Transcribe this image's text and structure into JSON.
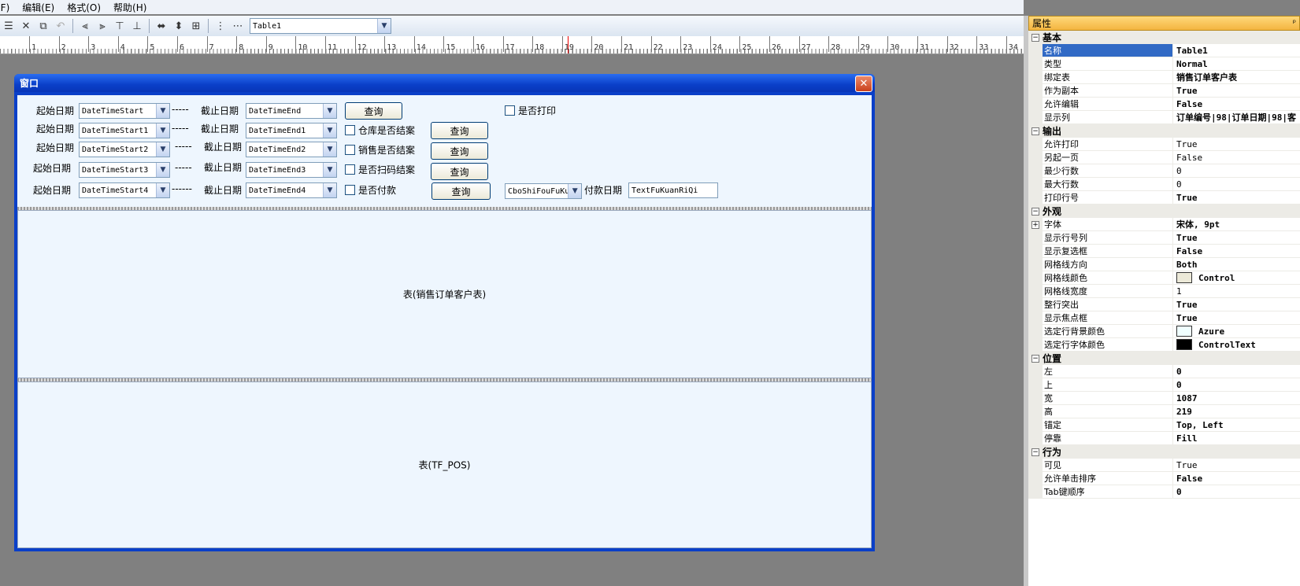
{
  "menu": [
    "文件(F)",
    "编辑(E)",
    "格式(O)",
    "帮助(H)"
  ],
  "toolbar": {
    "table_select": "Table1"
  },
  "ruler": {
    "numbers": [
      "1",
      "2",
      "3",
      "4",
      "5",
      "6",
      "7",
      "8",
      "9",
      "10",
      "11",
      "12",
      "13",
      "14",
      "15",
      "16",
      "17",
      "18",
      "19",
      "20",
      "21",
      "22",
      "23",
      "24",
      "25",
      "26",
      "27",
      "28",
      "29",
      "30",
      "31",
      "32",
      "33",
      "34"
    ]
  },
  "window": {
    "title": "窗口",
    "close": "✕",
    "rows": [
      {
        "start_label": "起始日期",
        "start_value": "DateTimeStart",
        "sep": "-----",
        "end_label": "截止日期",
        "end_value": "DateTimeEnd",
        "query": "查询",
        "check": "是否打印"
      },
      {
        "start_label": "起始日期",
        "start_value": "DateTimeStart1",
        "sep": "-----",
        "end_label": "截止日期",
        "end_value": "DateTimeEnd1",
        "check": "仓库是否结案",
        "query": "查询"
      },
      {
        "start_label": "起始日期",
        "start_value": "DateTimeStart2",
        "sep": "-----",
        "end_label": "截止日期",
        "end_value": "DateTimeEnd2",
        "check": "销售是否结案",
        "query": "查询"
      },
      {
        "start_label": "起始日期",
        "start_value": "DateTimeStart3",
        "sep": "-----",
        "end_label": "截止日期",
        "end_value": "DateTimeEnd3",
        "check": "是否扫码结案",
        "query": "查询"
      },
      {
        "start_label": "起始日期",
        "start_value": "DateTimeStart4",
        "sep": "------",
        "end_label": "截止日期",
        "end_value": "DateTimeEnd4",
        "check": "是否付款",
        "query": "查询",
        "combo": "CboShiFouFuKu",
        "pay_label": "付款日期",
        "pay_value": "TextFuKuanRiQi"
      }
    ],
    "table1_caption": "表(销售订单客户表)",
    "table2_caption": "表(TF_POS)"
  },
  "properties": {
    "title": "属性",
    "pin": "ᵖ",
    "sections": [
      {
        "name": "基本",
        "rows": [
          {
            "k": "名称",
            "v": "Table1",
            "bold": true,
            "selected": true
          },
          {
            "k": "类型",
            "v": "Normal",
            "bold": true
          },
          {
            "k": "绑定表",
            "v": "销售订单客户表",
            "bold": true
          },
          {
            "k": "作为副本",
            "v": "True",
            "bold": true
          },
          {
            "k": "允许编辑",
            "v": "False",
            "bold": true
          },
          {
            "k": "显示列",
            "v": "订单编号|98|订单日期|98|客",
            "bold": true
          }
        ]
      },
      {
        "name": "输出",
        "rows": [
          {
            "k": "允许打印",
            "v": "True"
          },
          {
            "k": "另起一页",
            "v": "False"
          },
          {
            "k": "最少行数",
            "v": "0"
          },
          {
            "k": "最大行数",
            "v": "0"
          },
          {
            "k": "打印行号",
            "v": "True",
            "bold": true
          }
        ]
      },
      {
        "name": "外观",
        "rows": [
          {
            "k": "字体",
            "v": "宋体, 9pt",
            "bold": true,
            "expand": "+"
          },
          {
            "k": "显示行号列",
            "v": "True",
            "bold": true
          },
          {
            "k": "显示复选框",
            "v": "False",
            "bold": true
          },
          {
            "k": "网格线方向",
            "v": "Both",
            "bold": true
          },
          {
            "k": "网格线颜色",
            "v": "Control",
            "bold": true,
            "swatch": "#ece9d8"
          },
          {
            "k": "网格线宽度",
            "v": "1"
          },
          {
            "k": "整行突出",
            "v": "True",
            "bold": true
          },
          {
            "k": "显示焦点框",
            "v": "True",
            "bold": true
          },
          {
            "k": "选定行背景颜色",
            "v": "Azure",
            "bold": true,
            "swatch": "#f0ffff"
          },
          {
            "k": "选定行字体颜色",
            "v": "ControlText",
            "bold": true,
            "swatch": "#000000"
          }
        ]
      },
      {
        "name": "位置",
        "rows": [
          {
            "k": "左",
            "v": "0",
            "bold": true
          },
          {
            "k": "上",
            "v": "0",
            "bold": true
          },
          {
            "k": "宽",
            "v": "1087",
            "bold": true
          },
          {
            "k": "高",
            "v": "219",
            "bold": true
          },
          {
            "k": "锚定",
            "v": "Top, Left",
            "bold": true
          },
          {
            "k": "停靠",
            "v": "Fill",
            "bold": true
          }
        ]
      },
      {
        "name": "行为",
        "rows": [
          {
            "k": "可见",
            "v": "True"
          },
          {
            "k": "允许单击排序",
            "v": "False",
            "bold": true
          },
          {
            "k": "Tab键顺序",
            "v": "0",
            "bold": true
          }
        ]
      }
    ]
  }
}
